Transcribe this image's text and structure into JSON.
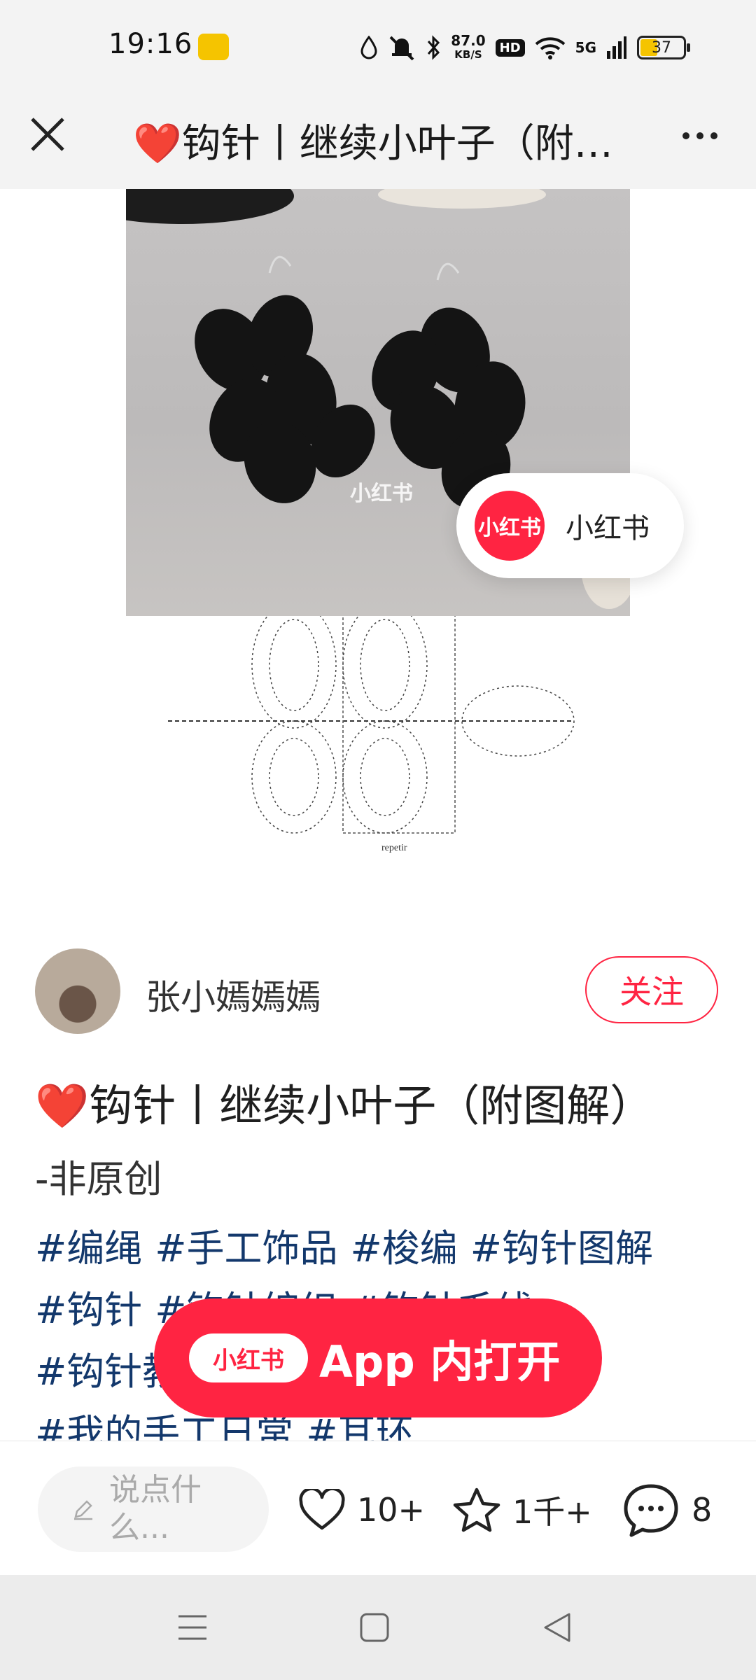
{
  "status_bar": {
    "time": "19:16",
    "app_icon": "game-app-icon",
    "net_speed_value": "87.0",
    "net_speed_unit": "KB/S",
    "hd_label": "HD",
    "network_label": "5G",
    "battery_level": "37",
    "battery_fraction": 0.37,
    "icons": [
      "drop-icon",
      "mute-icon",
      "bluetooth-icon",
      "wifi-icon",
      "signal-icon",
      "battery-icon"
    ]
  },
  "header": {
    "title": "❤️钩针丨继续小叶子（附图解）-非原创",
    "close_icon": "close-icon",
    "more_icon": "more-icon"
  },
  "hero": {
    "watermark": "小红书",
    "chart_caption": "repetir",
    "overlay_brand": "小红书",
    "overlay_label": "小红书"
  },
  "author": {
    "name": "张小嫣嫣嫣",
    "follow_label": "关注"
  },
  "note": {
    "title": "❤️钩针丨继续小叶子（附图解）",
    "subtitle": "-非原创",
    "tags": [
      "#编绳",
      "#手工饰品",
      "#梭编",
      "#钩针图解",
      "#钩针",
      "#钩针编织",
      "#钩针毛线",
      "#钩针教程",
      "#我的手工日常",
      "#耳环"
    ]
  },
  "open_app": {
    "logo": "小红书",
    "label": "App 内打开"
  },
  "bottom_bar": {
    "comment_placeholder": "说点什么...",
    "likes": "10+",
    "collects": "1千+",
    "comments": "8"
  },
  "nav": {
    "menu_icon": "menu-icon",
    "home_icon": "home-icon",
    "back_icon": "back-icon"
  },
  "colors": {
    "brand_red": "#ff2442",
    "tag_blue": "#13386c",
    "bar_grey": "#f3f3f3"
  }
}
